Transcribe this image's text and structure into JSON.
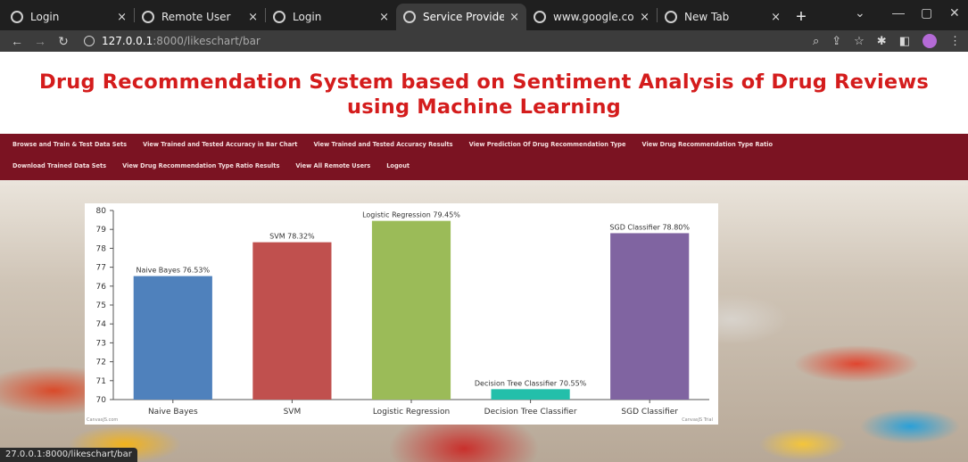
{
  "browser": {
    "tabs": [
      {
        "title": "Login",
        "active": false
      },
      {
        "title": "Remote User",
        "active": false
      },
      {
        "title": "Login",
        "active": false
      },
      {
        "title": "Service Provider",
        "active": true
      },
      {
        "title": "www.google.com",
        "active": false
      },
      {
        "title": "New Tab",
        "active": false
      }
    ],
    "tab_close_glyph": "×",
    "new_tab_glyph": "+",
    "url_host": "127.0.0.1",
    "url_path": ":8000/likeschart/bar",
    "status_url": "27.0.0.1:8000/likeschart/bar"
  },
  "page": {
    "title_line1": "Drug Recommendation System based on Sentiment Analysis of Drug Reviews",
    "title_line2": "using Machine Learning",
    "title_color": "#d41c1c",
    "nav_color": "#7b1322",
    "nav_row1": [
      "Browse and Train & Test Data Sets",
      "View Trained and Tested Accuracy in Bar Chart",
      "View Trained and Tested Accuracy Results",
      "View Prediction Of Drug Recommendation Type",
      "View Drug Recommendation Type Ratio"
    ],
    "nav_row2": [
      "Download Trained Data Sets",
      "View Drug Recommendation Type Ratio Results",
      "View All Remote Users",
      "Logout"
    ]
  },
  "chart_data": {
    "type": "bar",
    "categories": [
      "Naive Bayes",
      "SVM",
      "Logistic Regression",
      "Decision Tree Classifier",
      "SGD Classifier"
    ],
    "values": [
      76.53,
      78.32,
      79.45,
      70.55,
      78.8
    ],
    "data_labels": [
      "Naive Bayes 76.53%",
      "SVM 78.32%",
      "Logistic Regression 79.45%",
      "Decision Tree Classifier 70.55%",
      "SGD Classifier 78.80%"
    ],
    "colors": [
      "#4f81bc",
      "#c0504e",
      "#9bbb58",
      "#23bfaa",
      "#8064a1"
    ],
    "yticks": [
      "70",
      "71",
      "72",
      "73",
      "74",
      "75",
      "76",
      "77",
      "78",
      "79",
      "80"
    ],
    "ylim": [
      70,
      80
    ],
    "grid": false,
    "watermark": "CanvasJS.com",
    "watermark_right": "CanvasJS Trial"
  }
}
